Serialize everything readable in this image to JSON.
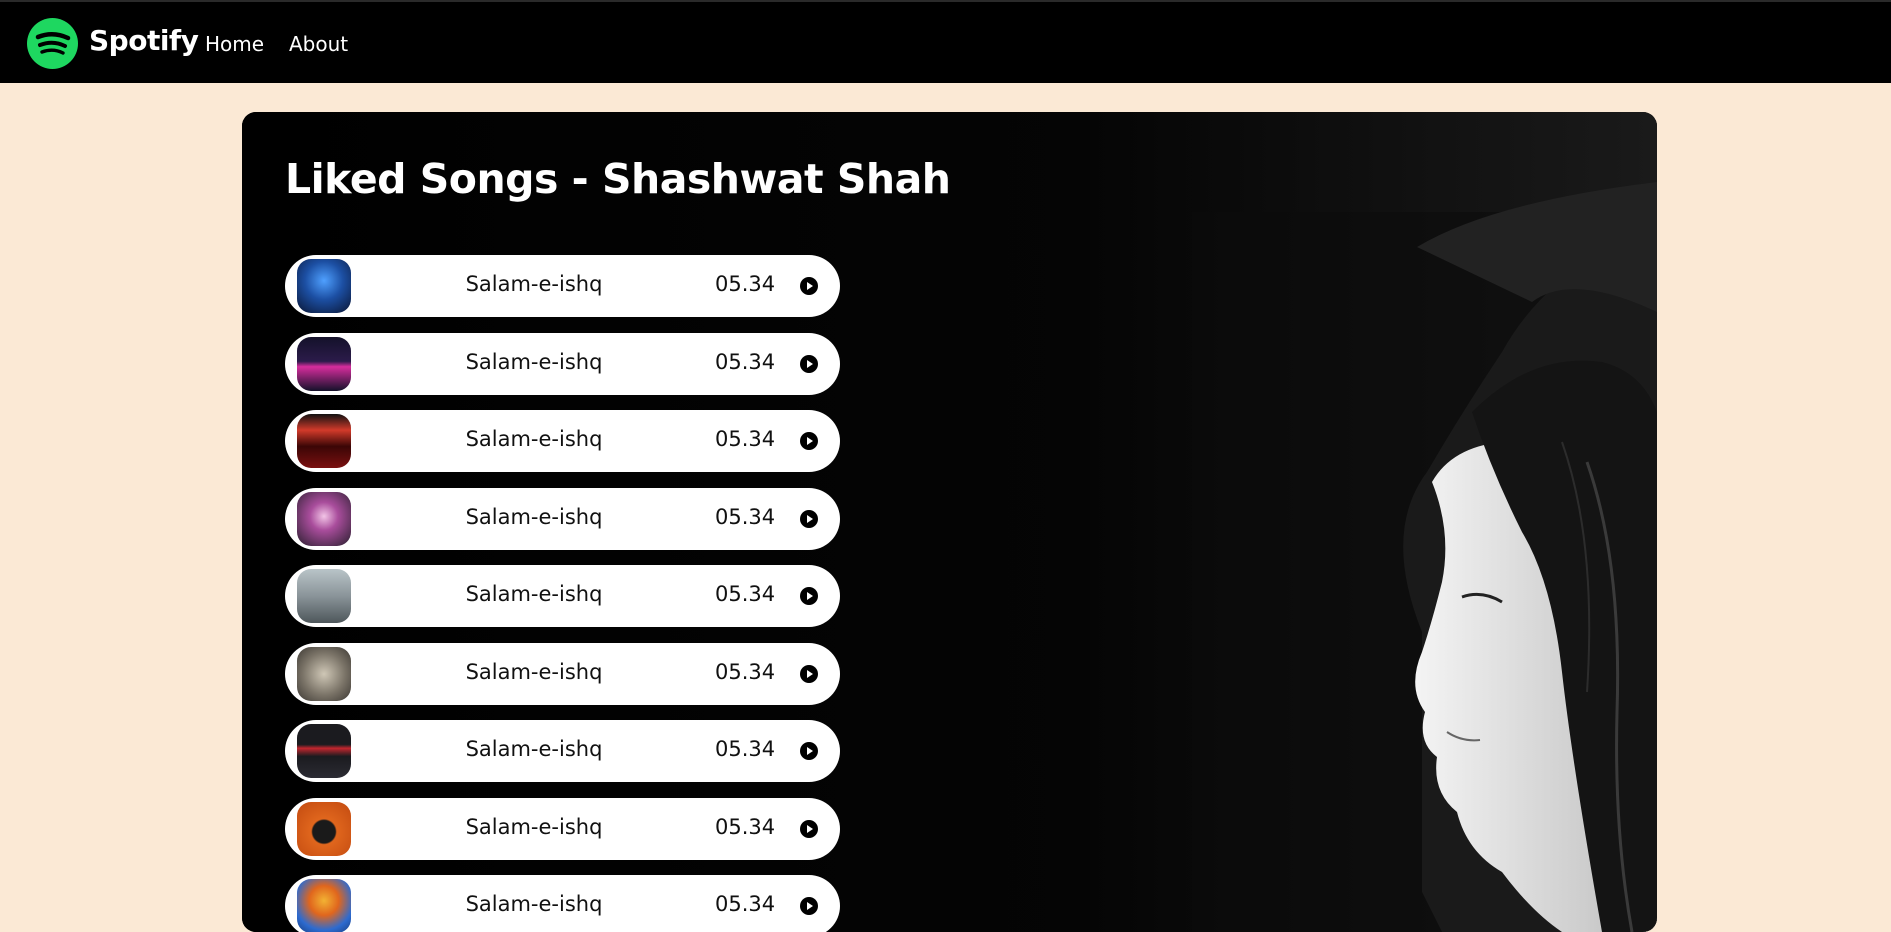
{
  "nav": {
    "logo_icon": "spotify-logo-icon",
    "brand": "Spotify",
    "links": [
      "Home",
      "About"
    ]
  },
  "main": {
    "title": "Liked Songs - Shashwat Shah",
    "songs": [
      {
        "name": "Salam-e-ishq",
        "duration": "05.34",
        "cover_color": "#1c4fa3"
      },
      {
        "name": "Salam-e-ishq",
        "duration": "05.34",
        "cover_color": "#1a1530"
      },
      {
        "name": "Salam-e-ishq",
        "duration": "05.34",
        "cover_color": "#5a0a0a"
      },
      {
        "name": "Salam-e-ishq",
        "duration": "05.34",
        "cover_color": "#3a2b3f"
      },
      {
        "name": "Salam-e-ishq",
        "duration": "05.34",
        "cover_color": "#8a9499"
      },
      {
        "name": "Salam-e-ishq",
        "duration": "05.34",
        "cover_color": "#7b7468"
      },
      {
        "name": "Salam-e-ishq",
        "duration": "05.34",
        "cover_color": "#1b1b1f"
      },
      {
        "name": "Salam-e-ishq",
        "duration": "05.34",
        "cover_color": "#e0661d"
      },
      {
        "name": "Salam-e-ishq",
        "duration": "05.34",
        "cover_color": "#2d6bd0"
      }
    ]
  },
  "colors": {
    "page_bg": "#fbe9d5",
    "navbar_bg": "#000000",
    "brand_green": "#1ed760",
    "panel_bg": "#000000",
    "song_row_bg": "#ffffff"
  }
}
